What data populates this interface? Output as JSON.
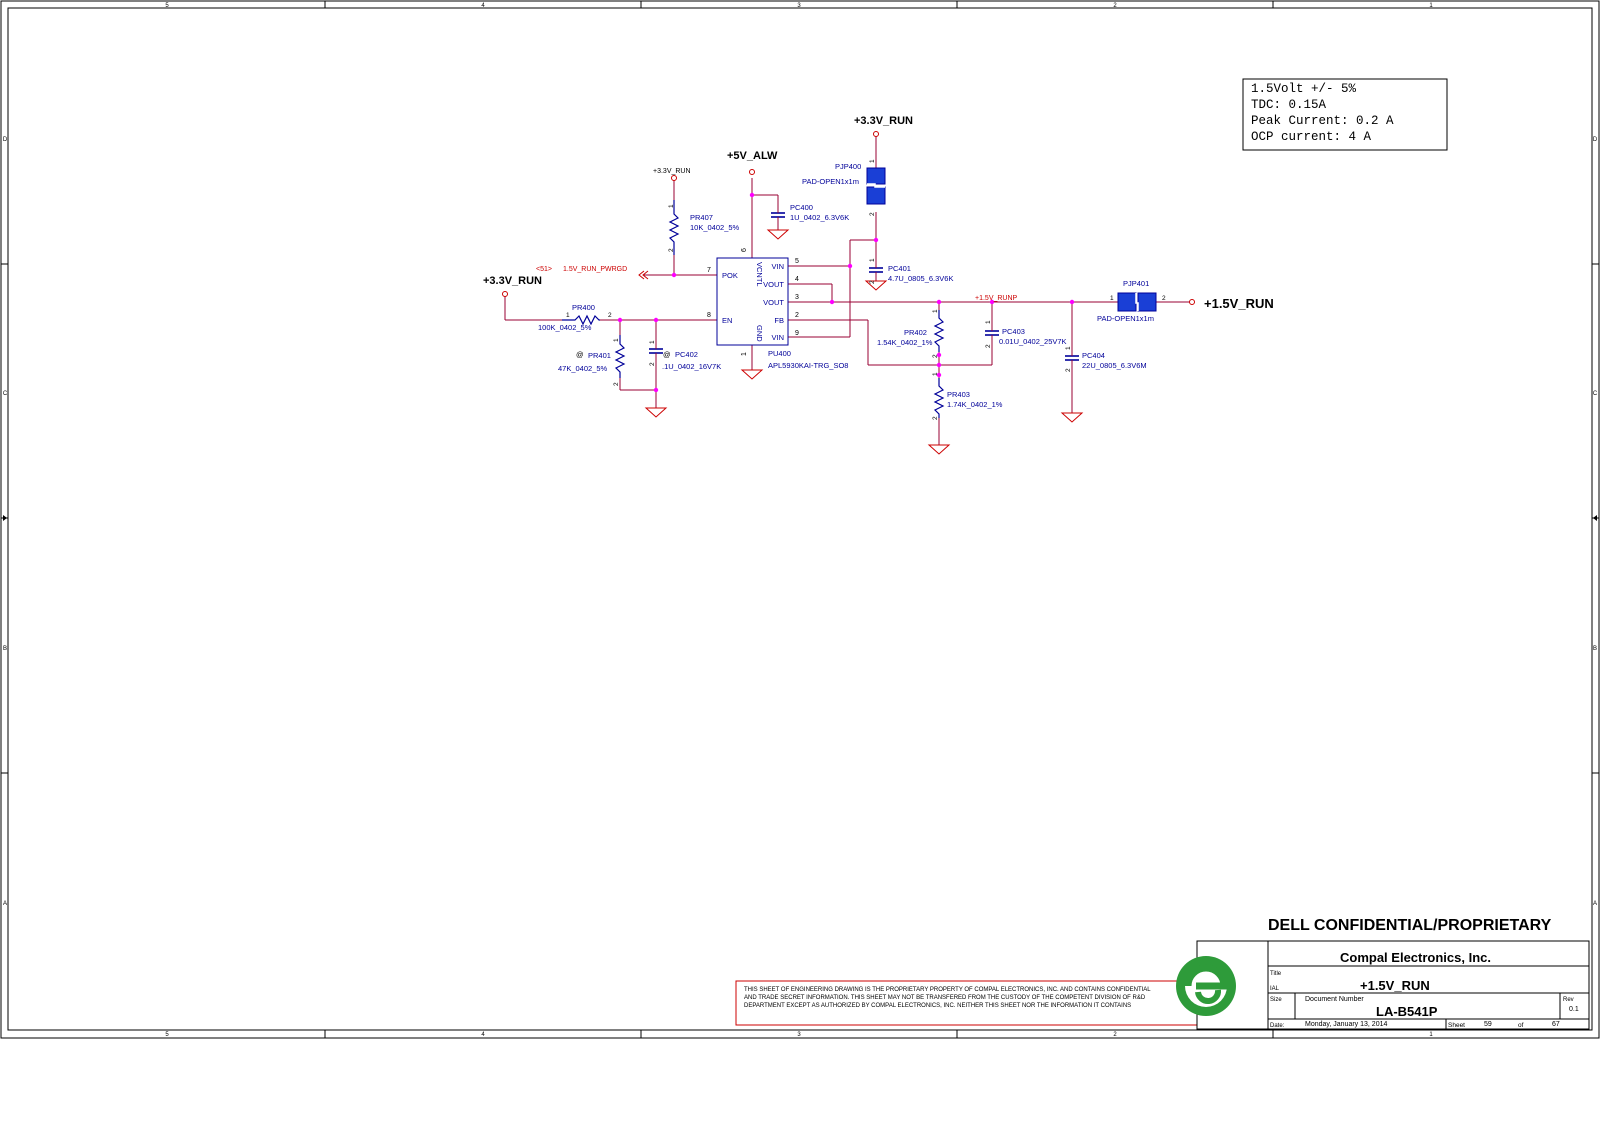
{
  "border": {
    "col_labels_top": [
      "5",
      "4",
      "3",
      "2",
      "1"
    ],
    "col_labels_bottom": [
      "5",
      "4",
      "3",
      "2",
      "1"
    ],
    "row_labels_left": [
      "D",
      "C",
      "B",
      "A"
    ],
    "row_labels_right": [
      "D",
      "C",
      "B",
      "A"
    ]
  },
  "spec_box": {
    "lines": [
      "1.5Volt +/- 5%",
      "TDC: 0.15A",
      "Peak Current:  0.2 A",
      "OCP current: 4 A"
    ]
  },
  "nets": {
    "v33_run_large_top": "+3.3V_RUN",
    "v5_alw": "+5V_ALW",
    "v33_run_small": "+3.3V_RUN",
    "v33_run_left": "+3.3V_RUN",
    "pwrgd_ref": "<51>",
    "pwrgd": "1.5V_RUN_PWRGD",
    "runp": "+1.5V_RUNP",
    "v15_run_out": "+1.5V_RUN"
  },
  "ic": {
    "ref": "PU400",
    "part": "APL5930KAI-TRG_SO8",
    "pins_left": [
      {
        "name": "POK",
        "num": "7"
      },
      {
        "name": "EN",
        "num": "8"
      }
    ],
    "pins_right": [
      {
        "name": "VIN",
        "num": "5"
      },
      {
        "name": "VOUT",
        "num": "4"
      },
      {
        "name": "VOUT",
        "num": "3"
      },
      {
        "name": "FB",
        "num": "2"
      },
      {
        "name": "VIN",
        "num": "9"
      }
    ],
    "pin_top": {
      "name": "VCNTL",
      "num": "6"
    },
    "pin_bottom": {
      "name": "GND",
      "num": "1"
    }
  },
  "components": {
    "pr407": {
      "ref": "PR407",
      "value": "10K_0402_5%"
    },
    "pr400": {
      "ref": "PR400",
      "value": "100K_0402_5%"
    },
    "pr401": {
      "ref": "PR401",
      "value": "47K_0402_5%",
      "mark": "@"
    },
    "pc402": {
      "ref": "PC402",
      "value": ".1U_0402_16V7K",
      "mark": "@"
    },
    "pc400": {
      "ref": "PC400",
      "value": "1U_0402_6.3V6K"
    },
    "pjp400": {
      "ref": "PJP400",
      "value": "PAD-OPEN1x1m"
    },
    "pc401": {
      "ref": "PC401",
      "value": "4.7U_0805_6.3V6K"
    },
    "pr402": {
      "ref": "PR402",
      "value": "1.54K_0402_1%"
    },
    "pr403": {
      "ref": "PR403",
      "value": "1.74K_0402_1%"
    },
    "pc403": {
      "ref": "PC403",
      "value": "0.01U_0402_25V7K"
    },
    "pc404": {
      "ref": "PC404",
      "value": "22U_0805_6.3V6M"
    },
    "pjp401": {
      "ref": "PJP401",
      "value": "PAD-OPEN1x1m"
    }
  },
  "pin_numbers": {
    "one": "1",
    "two": "2"
  },
  "notice": {
    "lines": [
      "THIS SHEET OF ENGINEERING DRAWING IS THE PROPRIETARY PROPERTY OF COMPAL ELECTRONICS, INC. AND CONTAINS CONFIDENTIAL",
      "AND TRADE SECRET INFORMATION. THIS SHEET MAY NOT BE TRANSFERED FROM THE CUSTODY OF THE COMPETENT DIVISION OF R&D",
      "DEPARTMENT EXCEPT AS AUTHORIZED BY COMPAL ELECTRONICS, INC. NEITHER THIS SHEET NOR THE INFORMATION IT CONTAINS"
    ]
  },
  "title_block": {
    "confidential": "DELL CONFIDENTIAL/PROPRIETARY",
    "company": "Compal Electronics, Inc.",
    "title_label": "Title",
    "title": "+1.5V_RUN",
    "ial": "IAL",
    "size_label": "Size",
    "doc_label": "Document Number",
    "doc_number": "LA-B541P",
    "rev_label": "Rev",
    "rev": "0.1",
    "date_label": "Date:",
    "date": "Monday, January 13, 2014",
    "sheet_label": "Sheet",
    "sheet": "59",
    "of_label": "of",
    "total": "67"
  },
  "colors": {
    "wire": "#990033",
    "component": "#000099",
    "junction": "#ff00ff",
    "ground": "#cc0000",
    "pad_fill": "#1a3fd6",
    "logo_green": "#2e9b3a"
  }
}
